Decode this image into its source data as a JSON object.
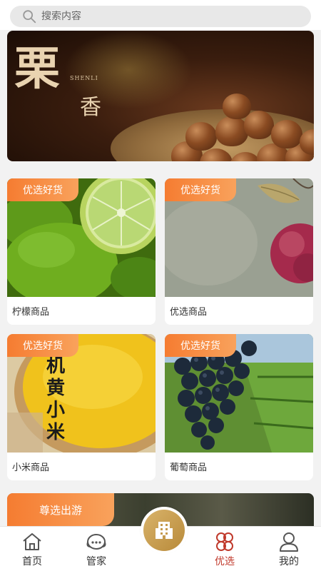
{
  "search": {
    "placeholder": "搜索内容"
  },
  "banner": {
    "title_big": "栗",
    "title_small": "香",
    "title_en": "SHENLI"
  },
  "products": [
    {
      "tag": "优选好货",
      "name": "柠檬商品",
      "image": "lime-photo"
    },
    {
      "tag": "优选好货",
      "name": "优选商品",
      "image": "apple-photo"
    },
    {
      "tag": "优选好货",
      "name": "小米商品",
      "image": "millet-photo",
      "image_text": [
        "机",
        "黄",
        "小",
        "米"
      ]
    },
    {
      "tag": "优选好货",
      "name": "葡萄商品",
      "image": "grape-photo"
    }
  ],
  "travel": {
    "tag": "尊选出游"
  },
  "tabbar": {
    "items": [
      {
        "label": "首页",
        "icon": "home-icon"
      },
      {
        "label": "管家",
        "icon": "headset-icon"
      },
      {
        "label": "",
        "icon": "building-icon"
      },
      {
        "label": "优选",
        "icon": "clover-icon",
        "active": true
      },
      {
        "label": "我的",
        "icon": "user-icon"
      }
    ],
    "active_color": "#c0392b"
  },
  "colors": {
    "tag_orange": "#f57c31",
    "accent_gold": "#c9a052"
  }
}
